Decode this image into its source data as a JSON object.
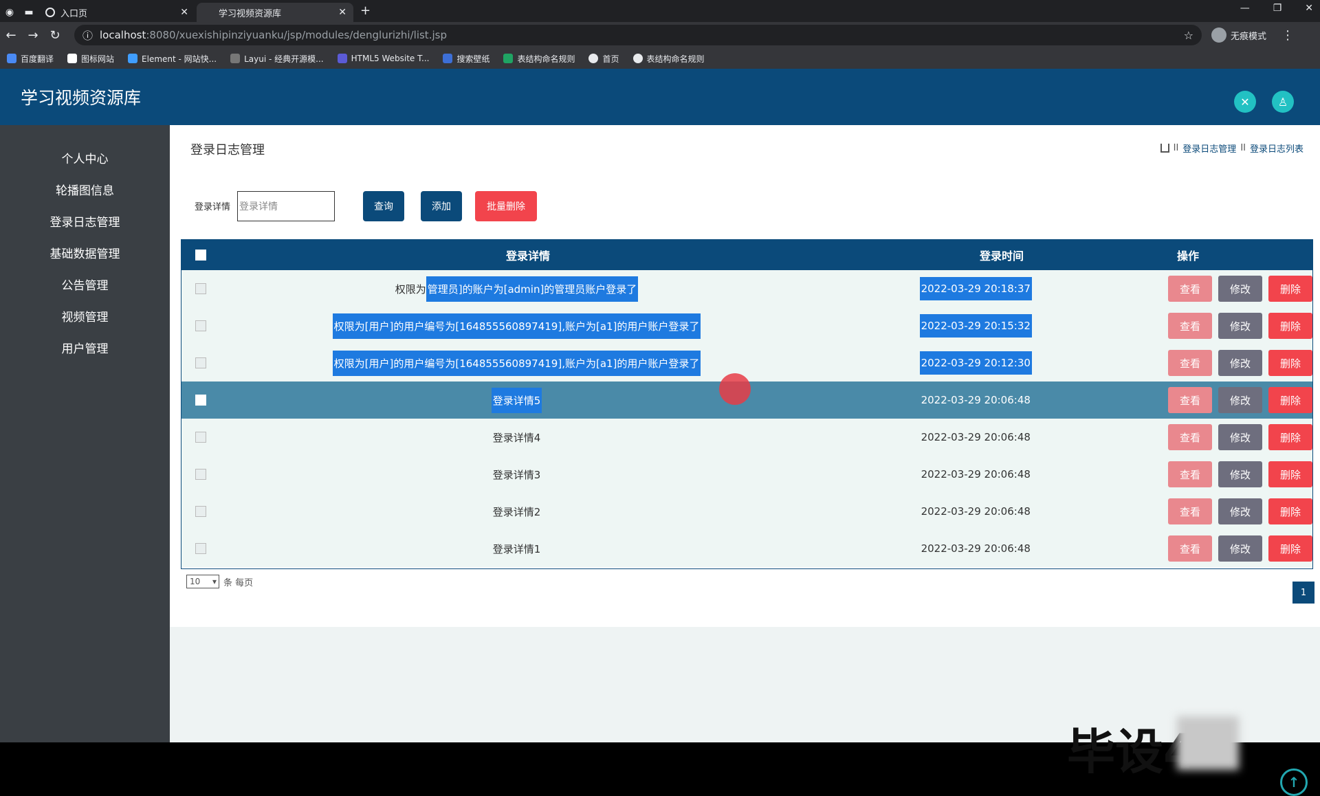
{
  "browser": {
    "tabs": [
      {
        "label": "入口页",
        "active": false
      },
      {
        "label": "学习视频资源库",
        "active": true
      }
    ],
    "url_host": "localhost",
    "url_path": ":8080/xuexishipinziyuanku/jsp/modules/denglurizhi/list.jsp",
    "incognito_label": "无痕模式",
    "bookmarks": [
      "百度翻译",
      "图标网站",
      "Element - 网站快...",
      "Layui - 经典开源模...",
      "HTML5 Website T...",
      "搜索壁纸",
      "表结构命名规则",
      "首页",
      "表结构命名规则"
    ]
  },
  "app": {
    "title": "学习视频资源库",
    "sidebar": [
      "个人中心",
      "轮播图信息",
      "登录日志管理",
      "基础数据管理",
      "公告管理",
      "视频管理",
      "用户管理"
    ],
    "page_title": "登录日志管理",
    "breadcrumb": [
      "登录日志管理",
      "登录日志列表"
    ],
    "search": {
      "label": "登录详情",
      "placeholder": "登录详情"
    },
    "buttons": {
      "query": "查询",
      "add": "添加",
      "batch_delete": "批量删除"
    },
    "table": {
      "headers": [
        "登录详情",
        "登录时间",
        "操作"
      ],
      "rows": [
        {
          "detail_pre": "权限为",
          "detail_sel": "管理员]的账户为[admin]的管理员账户登录了",
          "time": "2022-03-29 20:18:37"
        },
        {
          "detail_pre": "",
          "detail_sel": "权限为[用户]的用户编号为[164855560897419],账户为[a1]的用户账户登录了",
          "time": "2022-03-29 20:15:32"
        },
        {
          "detail_pre": "",
          "detail_sel": "权限为[用户]的用户编号为[164855560897419],账户为[a1]的用户账户登录了",
          "time": "2022-03-29 20:12:30"
        },
        {
          "detail_pre": "",
          "detail_sel": "登录详情5",
          "time": "2022-03-29 20:06:48"
        },
        {
          "detail_pre": "登录详情4",
          "detail_sel": "",
          "time": "2022-03-29 20:06:48"
        },
        {
          "detail_pre": "登录详情3",
          "detail_sel": "",
          "time": "2022-03-29 20:06:48"
        },
        {
          "detail_pre": "登录详情2",
          "detail_sel": "",
          "time": "2022-03-29 20:06:48"
        },
        {
          "detail_pre": "登录详情1",
          "detail_sel": "",
          "time": "2022-03-29 20:06:48"
        }
      ],
      "actions": {
        "view": "查看",
        "edit": "修改",
        "delete": "删除"
      }
    },
    "pager": {
      "per_page": "10",
      "per_page_suffix": "条 每页",
      "current_page": "1"
    },
    "watermark": "毕设4"
  }
}
